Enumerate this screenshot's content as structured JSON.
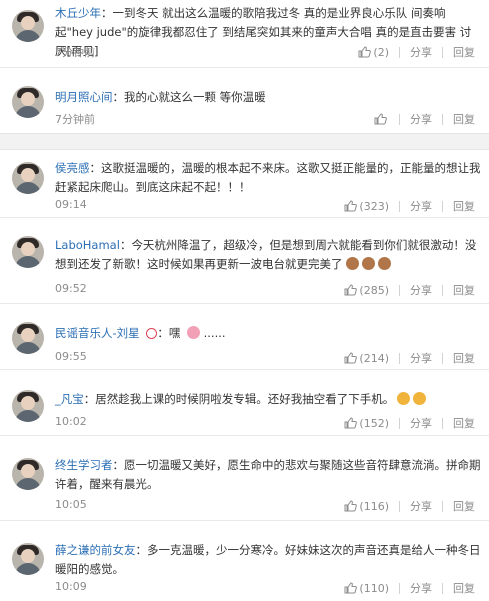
{
  "comments": [
    {
      "name": "木丘少年",
      "text": "一到冬天 就出这么温暖的歌陪我过冬 真的是业界良心乐队 间奏响起\"hey jude\"的旋律我都忍住了 到结尾突如其来的童声大合唱 真的是直击要害 讨厌[再见]",
      "time": "7分钟前",
      "likes": "(2)",
      "share": "分享",
      "reply": "回复"
    },
    {
      "name": "明月照心间",
      "text": "我的心就这么一颗 等你温暖",
      "time": "7分钟前",
      "likes": "",
      "share": "分享",
      "reply": "回复"
    },
    {
      "name": "侯亮感",
      "text": "这歌挺温暖的，温暖的根本起不来床。这歌又挺正能量的，正能量的想让我赶紧起床爬山。到底这床起不起！！！",
      "time": "09:14",
      "likes": "(323)",
      "share": "分享",
      "reply": "回复"
    },
    {
      "name": "LaboHamal",
      "text": "今天杭州降温了，超级冷，但是想到周六就能看到你们就很激动！没想到还发了新歌！这时候如果再更新一波电台就更完美了",
      "time": "09:52",
      "likes": "(285)",
      "share": "分享",
      "reply": "回复"
    },
    {
      "name": "民谣音乐人-刘星",
      "text": "嘿",
      "suffix": "......",
      "time": "09:55",
      "likes": "(214)",
      "share": "分享",
      "reply": "回复"
    },
    {
      "name": "_凡宝",
      "text": "居然趁我上课的时候阴啦发专辑。还好我抽空看了下手机。",
      "time": "10:02",
      "likes": "(152)",
      "share": "分享",
      "reply": "回复"
    },
    {
      "name": "终生学习者",
      "text": "愿一切温暖又美好，愿生命中的悲欢与聚随这些音符肆意流淌。拼命期许着，醒来有晨光。",
      "time": "10:05",
      "likes": "(116)",
      "share": "分享",
      "reply": "回复"
    },
    {
      "name": "薛之谦的前女友",
      "text": "多一克温暖，少一分寒冷。好妹妹这次的声音还真是给人一种冬日暖阳的感觉。",
      "time": "10:09",
      "likes": "(110)",
      "share": "分享",
      "reply": "回复"
    }
  ],
  "colors": {
    "name": "#2c6fb5",
    "meta": "#8c8c8c",
    "text": "#333333"
  }
}
